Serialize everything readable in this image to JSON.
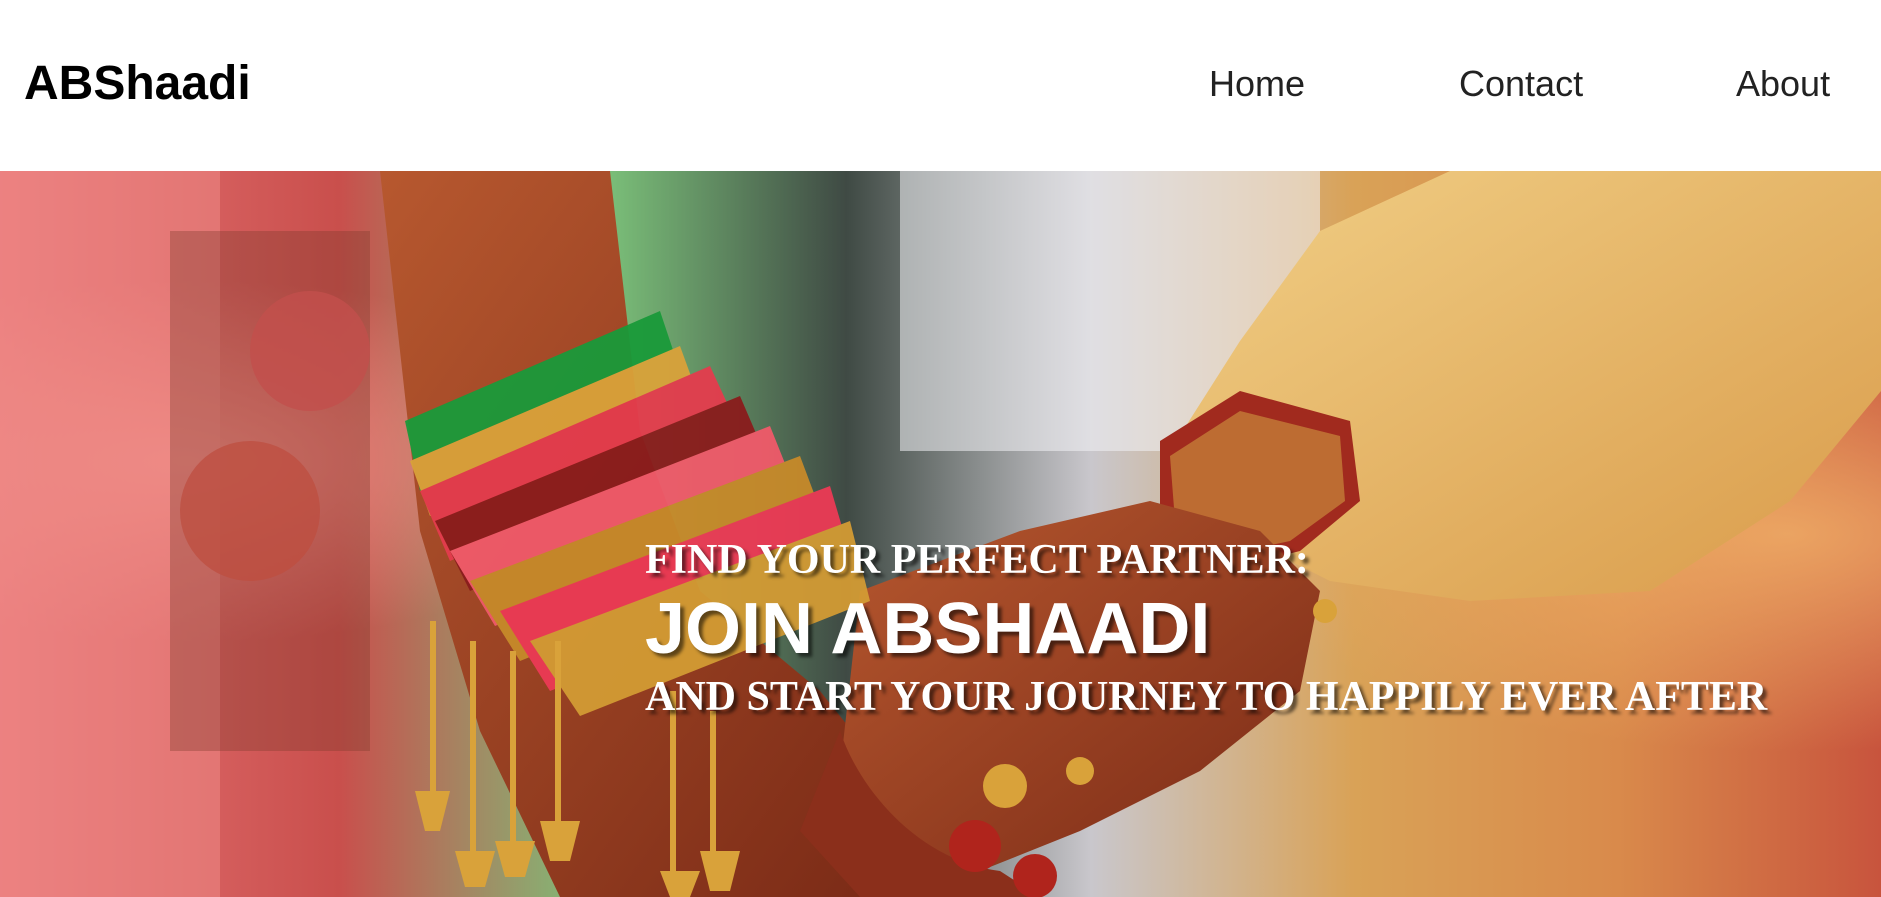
{
  "navbar": {
    "brand": "ABShaadi",
    "links": [
      {
        "label": "Home"
      },
      {
        "label": "Contact"
      },
      {
        "label": "About"
      }
    ]
  },
  "hero": {
    "line1": "FIND YOUR PERFECT PARTNER:",
    "line2": "JOIN ABSHAADI",
    "line3": "AND START YOUR JOURNEY TO HAPPILY EVER AFTER",
    "text_color": "#ffffff"
  }
}
